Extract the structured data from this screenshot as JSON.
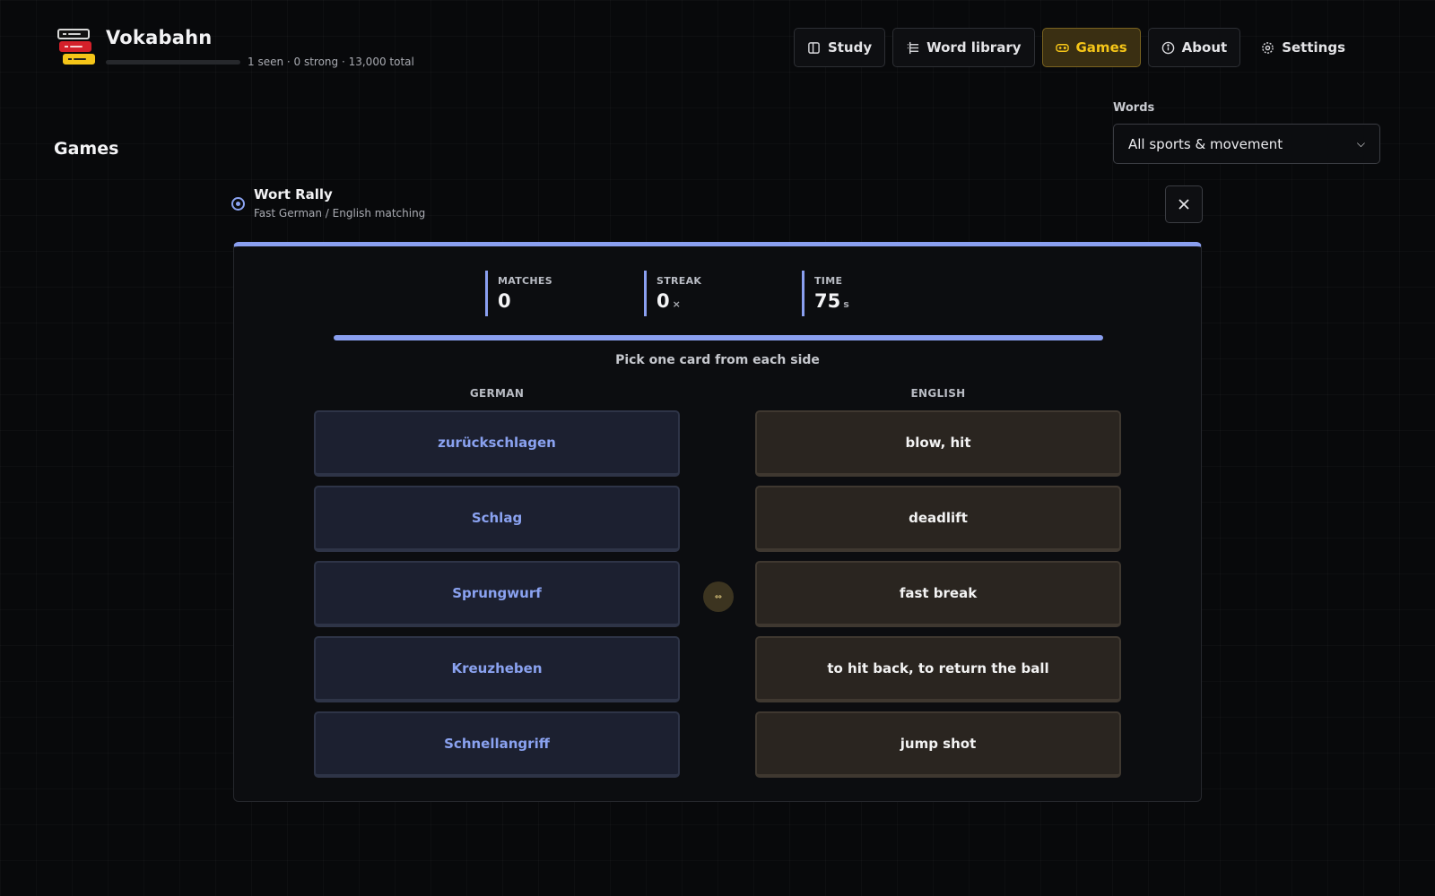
{
  "app": {
    "title": "Vokabahn",
    "stats": "1 seen · 0 strong · 13,000 total"
  },
  "nav": {
    "study": "Study",
    "word_library": "Word library",
    "games": "Games",
    "about": "About",
    "settings": "Settings",
    "active": "Games"
  },
  "page": {
    "title": "Games"
  },
  "words_filter": {
    "label": "Words",
    "selected": "All sports & movement"
  },
  "game": {
    "name": "Wort Rally",
    "description": "Fast German / English matching"
  },
  "stats": {
    "matches_label": "MATCHES",
    "matches": "0",
    "streak_label": "STREAK",
    "streak": "0",
    "streak_unit": "×",
    "time_label": "TIME",
    "time": "75",
    "time_unit": "s"
  },
  "instruction": "Pick one card from each side",
  "columns": {
    "german_label": "GERMAN",
    "english_label": "ENGLISH"
  },
  "german_cards": [
    "zurückschlagen",
    "Schlag",
    "Sprungwurf",
    "Kreuzheben",
    "Schnellangriff"
  ],
  "english_cards": [
    "blow, hit",
    "deadlift",
    "fast break",
    "to hit back, to return the ball",
    "jump shot"
  ],
  "colors": {
    "accent": "#8a9ff0",
    "active_tab": "#f5c518",
    "background": "#08090b"
  }
}
